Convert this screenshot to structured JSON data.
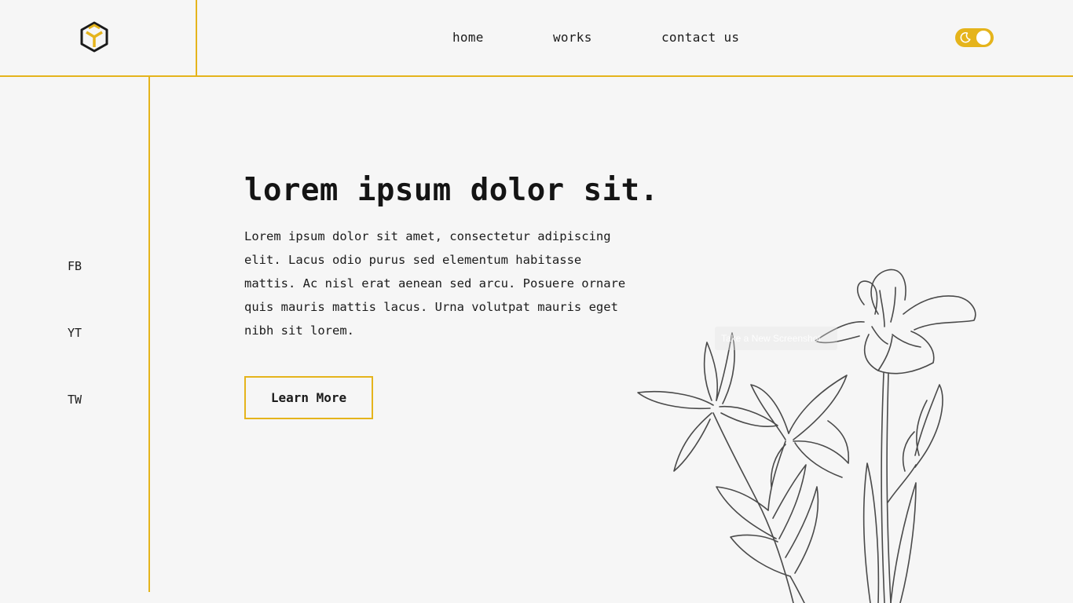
{
  "nav": {
    "home": "home",
    "works": "works",
    "contact": "contact us"
  },
  "theme_toggle": {
    "icon": "moon-icon",
    "state": "light"
  },
  "social": {
    "fb": "FB",
    "yt": "YT",
    "tw": "TW"
  },
  "hero": {
    "title": "lorem ipsum dolor sit.",
    "body": "Lorem ipsum dolor sit amet, consectetur adipiscing elit. Lacus odio purus sed elementum habitasse mattis. Ac nisl erat aenean sed arcu. Posuere ornare quis mauris mattis lacus. Urna volutpat mauris eget nibh sit lorem.",
    "cta": "Learn More"
  },
  "overlay": {
    "tooltip": "Take a New Screenshot"
  },
  "colors": {
    "accent": "#e5b41c",
    "background": "#f6f6f6",
    "text": "#1b1b1b",
    "illustration_stroke": "#4a4a4a"
  }
}
